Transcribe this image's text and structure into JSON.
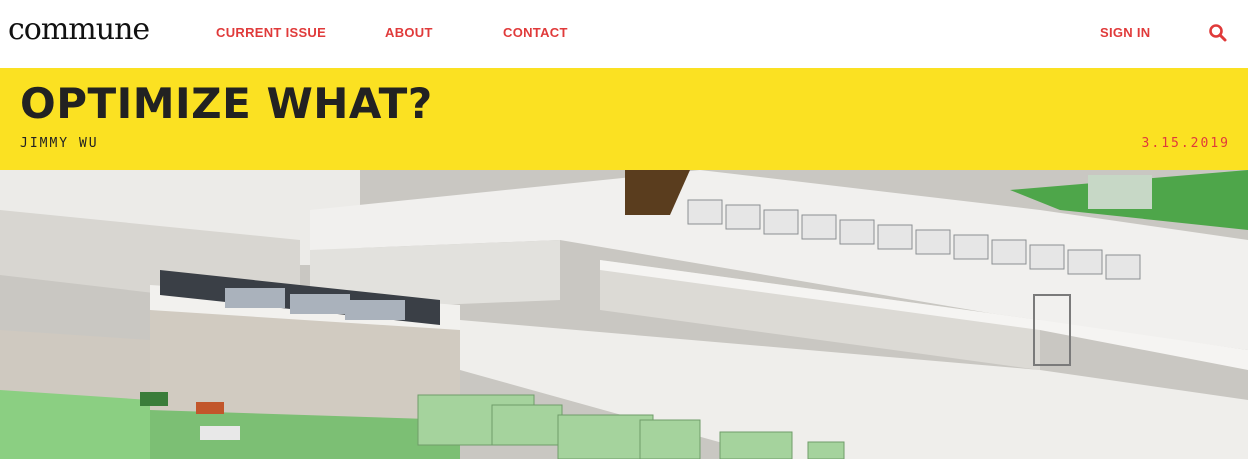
{
  "header": {
    "logo": "commune",
    "nav": [
      {
        "label": "CURRENT ISSUE"
      },
      {
        "label": "ABOUT"
      },
      {
        "label": "CONTACT"
      }
    ],
    "sign_in": "SIGN IN",
    "search_icon": "search-icon"
  },
  "article": {
    "title": "OPTIMIZE WHAT?",
    "author": "JIMMY WU",
    "date": "3.15.2019"
  },
  "colors": {
    "banner": "#fbe122",
    "accent": "#e03a3a",
    "text": "#222222"
  }
}
